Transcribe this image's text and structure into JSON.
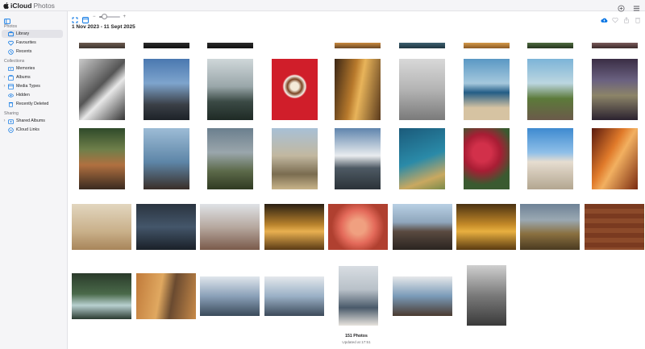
{
  "app": {
    "brand": "iCloud",
    "product": "Photos"
  },
  "icons": {
    "apple": "apple-logo-icon",
    "add": "plus-circle-icon",
    "apps": "grid-icon",
    "sidebar_toggle": "sidebar-toggle-icon",
    "upload": "upload-cloud-icon",
    "favorite": "heart-icon",
    "share": "share-icon",
    "delete": "trash-icon"
  },
  "sidebar": {
    "sections": [
      {
        "title": "Photos"
      },
      {
        "title": "Collections"
      },
      {
        "title": "Sharing"
      }
    ],
    "items": [
      {
        "label": "Library",
        "icon": "library-icon",
        "active": true
      },
      {
        "label": "Favourites",
        "icon": "heart-icon"
      },
      {
        "label": "Recents",
        "icon": "clock-icon"
      },
      {
        "label": "Memories",
        "icon": "memories-icon"
      },
      {
        "label": "Albums",
        "icon": "album-icon",
        "expandable": true
      },
      {
        "label": "Media Types",
        "icon": "media-types-icon",
        "expandable": true
      },
      {
        "label": "Hidden",
        "icon": "eye-slash-icon"
      },
      {
        "label": "Recently Deleted",
        "icon": "trash-icon"
      },
      {
        "label": "Shared Albums",
        "icon": "shared-album-icon",
        "expandable": true
      },
      {
        "label": "iCloud Links",
        "icon": "link-icon"
      }
    ]
  },
  "toolbar": {
    "slider_minus": "−",
    "slider_plus": "+",
    "zoom_level": 0.25
  },
  "main": {
    "date_range": "1 Nov 2023 - 11 Sept 2025",
    "photo_count": "151 Photos",
    "updated": "Updated at 17:51"
  },
  "colors": {
    "sidebar_bg": "#f5f5f7",
    "selection": "#e3e3e8",
    "accent": "#0071e3"
  }
}
